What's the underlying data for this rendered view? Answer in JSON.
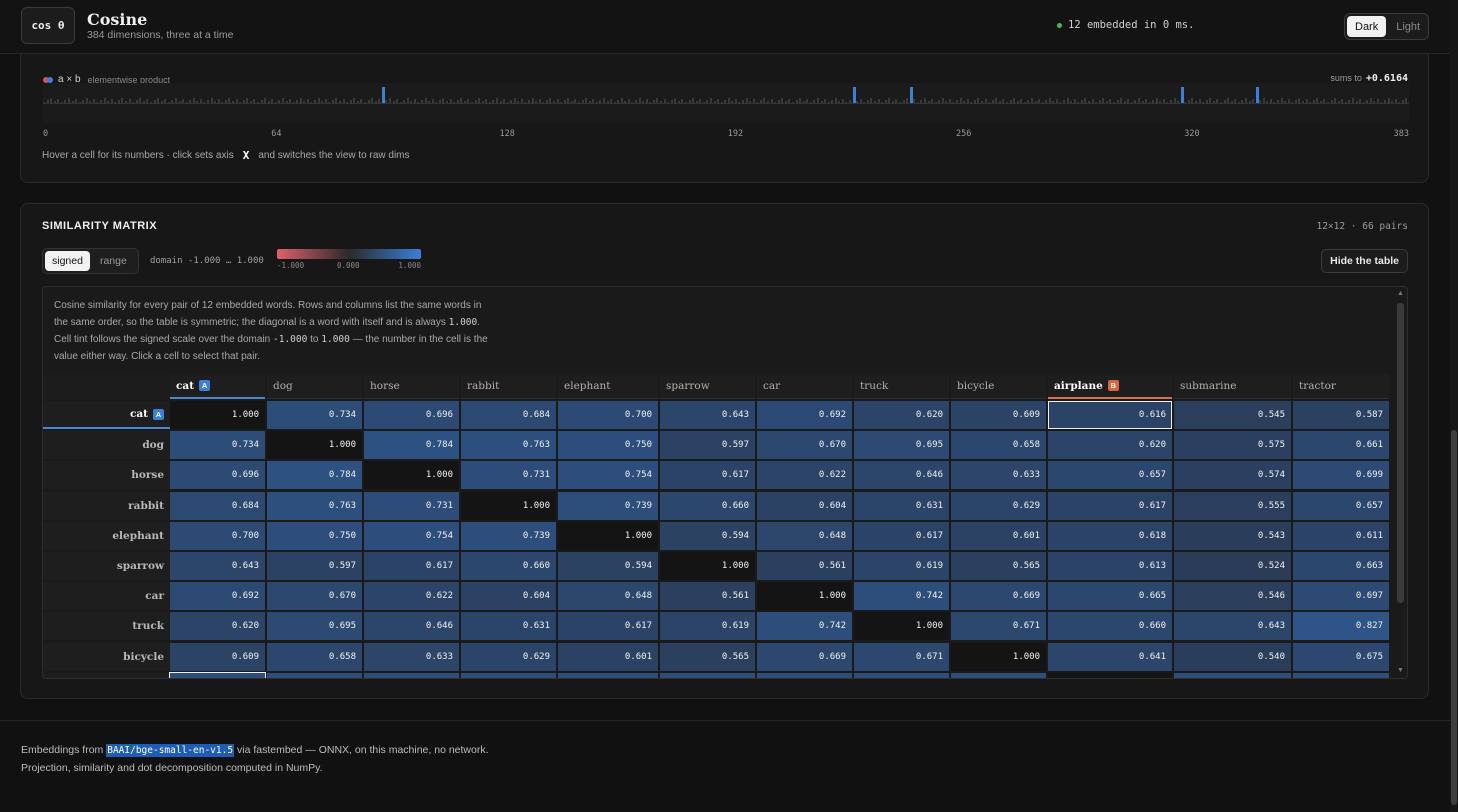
{
  "header": {
    "logo": "cos θ",
    "title": "Cosine",
    "subtitle": "384 dimensions, three at a time",
    "status": "12 embedded in 0 ms.",
    "status_color": "#3fbf5a",
    "theme": {
      "dark_label": "Dark",
      "light_label": "Light",
      "active": "Dark"
    }
  },
  "dims": {
    "legend_label": "a × b",
    "legend_sub": "elementwise product",
    "legend_colors": [
      "#d9534f",
      "#3b7fd9"
    ],
    "sums_label": "sums to",
    "sums_value": "+0.6164",
    "axis_ticks": [
      "0",
      "64",
      "128",
      "192",
      "256",
      "320",
      "383"
    ],
    "highlighted_dims": [
      95,
      227,
      243,
      319,
      340
    ],
    "hover_note_before": "Hover a cell for its numbers · click sets axis",
    "hover_note_key": "X",
    "hover_note_after": "and switches the view to raw dims"
  },
  "similarity": {
    "title": "SIMILARITY MATRIX",
    "pairs": "12×12 · 66 pairs",
    "mode": {
      "signed_label": "signed",
      "range_label": "range",
      "active": "signed"
    },
    "domain_label": "domain -1.000 … 1.000",
    "scale": {
      "min": "-1.000",
      "mid": "0.000",
      "max": "1.000",
      "neg_color": "#e0606a",
      "pos_color": "#3b7fd9"
    },
    "hide_button": "Hide the table",
    "caption": {
      "p1": "Cosine similarity for every pair of 12 embedded words. Rows and columns list the same words in the same order, so the table is symmetric; the diagonal is a word with itself and is always",
      "v1": "1.000",
      "p2": ". Cell tint follows the signed scale over the domain",
      "v2": "-1.000",
      "p3": "to",
      "v3": "1.000",
      "p4": "— the number in the cell is the value either way. Click a cell to select that pair."
    },
    "words": [
      "cat",
      "dog",
      "horse",
      "rabbit",
      "elephant",
      "sparrow",
      "car",
      "truck",
      "bicycle",
      "airplane",
      "submarine",
      "tractor"
    ],
    "selected_a": "cat",
    "selected_b": "airplane",
    "badge_a": "A",
    "badge_b": "B",
    "rows": [
      [
        "1.000",
        "0.734",
        "0.696",
        "0.684",
        "0.700",
        "0.643",
        "0.692",
        "0.620",
        "0.609",
        "0.616",
        "0.545",
        "0.587"
      ],
      [
        "0.734",
        "1.000",
        "0.784",
        "0.763",
        "0.750",
        "0.597",
        "0.670",
        "0.695",
        "0.658",
        "0.620",
        "0.575",
        "0.661"
      ],
      [
        "0.696",
        "0.784",
        "1.000",
        "0.731",
        "0.754",
        "0.617",
        "0.622",
        "0.646",
        "0.633",
        "0.657",
        "0.574",
        "0.699"
      ],
      [
        "0.684",
        "0.763",
        "0.731",
        "1.000",
        "0.739",
        "0.660",
        "0.604",
        "0.631",
        "0.629",
        "0.617",
        "0.555",
        "0.657"
      ],
      [
        "0.700",
        "0.750",
        "0.754",
        "0.739",
        "1.000",
        "0.594",
        "0.648",
        "0.617",
        "0.601",
        "0.618",
        "0.543",
        "0.611"
      ],
      [
        "0.643",
        "0.597",
        "0.617",
        "0.660",
        "0.594",
        "1.000",
        "0.561",
        "0.619",
        "0.565",
        "0.613",
        "0.524",
        "0.663"
      ],
      [
        "0.692",
        "0.670",
        "0.622",
        "0.604",
        "0.648",
        "0.561",
        "1.000",
        "0.742",
        "0.669",
        "0.665",
        "0.546",
        "0.697"
      ],
      [
        "0.620",
        "0.695",
        "0.646",
        "0.631",
        "0.617",
        "0.619",
        "0.742",
        "1.000",
        "0.671",
        "0.660",
        "0.643",
        "0.827"
      ],
      [
        "0.609",
        "0.658",
        "0.633",
        "0.629",
        "0.601",
        "0.565",
        "0.669",
        "0.671",
        "1.000",
        "0.641",
        "0.540",
        "0.675"
      ]
    ]
  },
  "footer": {
    "line1_before": "Embeddings from",
    "model": "BAAI/bge-small-en-v1.5",
    "line1_after": "via fastembed — ONNX, on this machine, no network.",
    "line2": "Projection, similarity and dot decomposition computed in NumPy."
  }
}
